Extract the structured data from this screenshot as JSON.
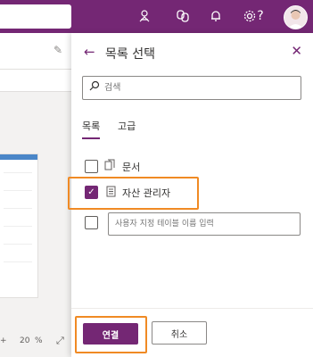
{
  "topbar": {
    "icons": [
      "environment-icon",
      "copilot-icon",
      "bell-icon",
      "gear-icon",
      "help-icon",
      "avatar"
    ],
    "help_glyph": "?",
    "color": "#742774"
  },
  "background": {
    "zoom_value": "20",
    "zoom_unit": "%"
  },
  "panel": {
    "title": "목록 선택",
    "search": {
      "placeholder": "검색"
    },
    "tabs": [
      {
        "label": "목록",
        "active": true
      },
      {
        "label": "고급",
        "active": false
      }
    ],
    "items": [
      {
        "label": "문서",
        "checked": false,
        "icon": "document-library-icon"
      },
      {
        "label": "자산 관리자",
        "checked": true,
        "icon": "list-icon"
      }
    ],
    "custom_table": {
      "placeholder": "사용자 지정 테이블 이름 입력",
      "checked": false
    },
    "buttons": {
      "connect": "연결",
      "cancel": "취소"
    },
    "accent": "#742774",
    "highlight_color": "#f08a24"
  }
}
